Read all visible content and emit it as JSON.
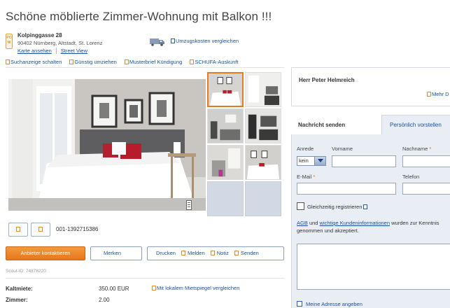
{
  "listing": {
    "title": "Schöne möblierte Zimmer-Wohnung mit Balkon !!!",
    "address": {
      "pin_text": "PO NI",
      "street": "Kolpinggasse 28",
      "city": "90402 Nürnberg, Altstadt, St. Lorenz",
      "map_link": "Karte ansehen",
      "street_view_link": "Street View"
    },
    "umzug_link": "Umzugskosten vergleichen",
    "top_links": [
      "Suchanzeige schalten",
      "Günstig umziehen",
      "Musterbrief Kündigung",
      "SCHUFA-Auskunft"
    ],
    "scout_number": "001-1392715386",
    "buttons": {
      "contact": "Anbieter kontaktieren",
      "merken": "Merken",
      "drucken": "Drucken",
      "melden": "Melden",
      "notiz": "Notiz",
      "senden": "Senden"
    },
    "scout_id": "Scout-ID: 74878220",
    "details": [
      {
        "label": "Kaltmiete:",
        "value": "350.00 EUR"
      },
      {
        "label": "Zimmer:",
        "value": "2.00"
      }
    ],
    "mietspiegel_link": "Mit lokalem Mietspiegel vergleichen"
  },
  "contact": {
    "name": "Herr Peter Helmreich",
    "more": "Mehr D"
  },
  "form": {
    "tab_active": "Nachricht senden",
    "tab_inactive": "Persönlich vorstellen",
    "anrede_label": "Anrede",
    "anrede_value": "kein",
    "vorname_label": "Vorname",
    "nachname_label": "Nachname",
    "email_label": "E-Mail",
    "telefon_label": "Telefon",
    "required_marker": "*",
    "register_label": "Gleichzeitig registrieren",
    "agb_link": "AGB",
    "agb_und": "und",
    "kunden_link": "wichtige Kundeninformationen",
    "agb_rest": "wurden zur Kenntnis genommen und akzeptiert.",
    "adresse_label": "Meine Adresse angeben"
  },
  "colors": {
    "accent_orange": "#e5761d",
    "link_blue": "#1a4f9c",
    "panel_bg": "#e9eef5"
  }
}
